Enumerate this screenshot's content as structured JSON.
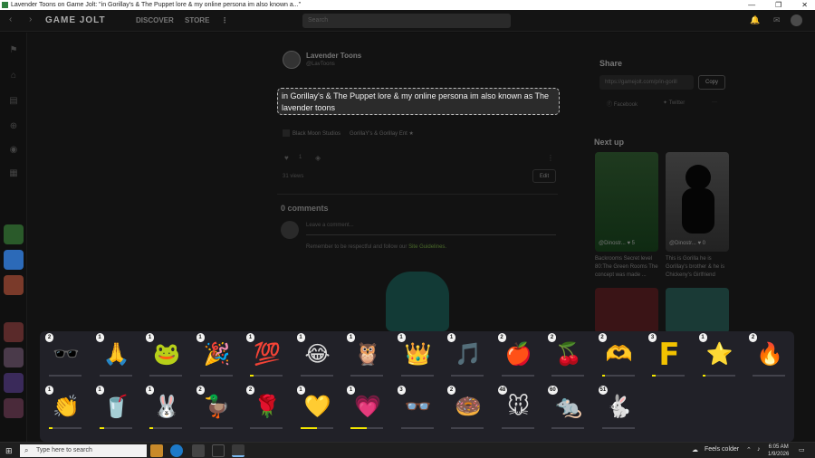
{
  "window": {
    "title": "Lavender Toons on Game Jolt: \"in Gorillay's & The Puppet lore & my online persona im also known a...\"",
    "controls": [
      "—",
      "❐",
      "✕"
    ]
  },
  "topbar": {
    "back": "‹",
    "forward": "›",
    "logo": "GAME JOLT",
    "discover": "DISCOVER",
    "store": "STORE",
    "more": "⋮",
    "search_placeholder": "Search"
  },
  "post": {
    "author": "Lavender Toons",
    "handle": "@LavToons",
    "body": "in Gorillay's & The Puppet lore & my online persona im also known as The lavender toons",
    "communities": [
      "Black Moon Studios",
      "GorillaY's & Gorillay Ent"
    ],
    "likes": "1",
    "views": "31 views",
    "edit_label": "Edit"
  },
  "comments": {
    "title": "0 comments",
    "placeholder": "Leave a comment...",
    "guidelines_prefix": "Remember to be respectful and follow our ",
    "guidelines_link": "Site Guidelines."
  },
  "share": {
    "title": "Share",
    "url": "https://gamejolt.com/p/in-gorill",
    "copy_label": "Copy",
    "facebook": "Facebook",
    "twitter": "Twitter",
    "more": "···"
  },
  "next_up": {
    "title": "Next up",
    "items": [
      {
        "user": "@Dinostr...",
        "likes": "5",
        "desc": "Backrooms Secret level 80:The Green Rooms The concept was made ..."
      },
      {
        "user": "@Dinostr...",
        "likes": "0",
        "desc": "This is Gorilla he is Gorillay's brother & he is Chickeny's Girlfriend"
      }
    ]
  },
  "stickers": [
    {
      "name": "sunglasses",
      "count": "2",
      "glyph": "🕶️",
      "progress": 0
    },
    {
      "name": "praying-hands",
      "count": "1",
      "glyph": "🙏",
      "progress": 0
    },
    {
      "name": "party-frog",
      "count": "1",
      "glyph": "🐸",
      "progress": 0
    },
    {
      "name": "party-popper",
      "count": "1",
      "glyph": "🎉",
      "progress": 0
    },
    {
      "name": "hundred",
      "count": "1",
      "glyph": "💯",
      "progress": 0.1
    },
    {
      "name": "laughing-face",
      "count": "1",
      "glyph": "😂",
      "progress": 0
    },
    {
      "name": "dizzy-owl",
      "count": "1",
      "glyph": "🦉",
      "progress": 0
    },
    {
      "name": "tiara",
      "count": "1",
      "glyph": "👑",
      "progress": 0
    },
    {
      "name": "music-notes",
      "count": "1",
      "glyph": "🎵",
      "progress": 0
    },
    {
      "name": "apple",
      "count": "2",
      "glyph": "🍎",
      "progress": 0
    },
    {
      "name": "cherries",
      "count": "2",
      "glyph": "🍒",
      "progress": 0
    },
    {
      "name": "heart-hands",
      "count": "2",
      "glyph": "🫶",
      "progress": 0.1
    },
    {
      "name": "letter-f",
      "count": "3",
      "glyph": "F",
      "progress": 0.1
    },
    {
      "name": "star",
      "count": "1",
      "glyph": "⭐",
      "progress": 0.1
    },
    {
      "name": "fire",
      "count": "2",
      "glyph": "🔥",
      "progress": 0
    },
    {
      "name": "clapping-hands",
      "count": "1",
      "glyph": "👏",
      "progress": 0.1
    },
    {
      "name": "chocolate-drink",
      "count": "1",
      "glyph": "🥤",
      "progress": 0.15
    },
    {
      "name": "green-bunny",
      "count": "1",
      "glyph": "🐰",
      "progress": 0.1
    },
    {
      "name": "duck",
      "count": "2",
      "glyph": "🦆",
      "progress": 0
    },
    {
      "name": "rose",
      "count": "2",
      "glyph": "🌹",
      "progress": 0
    },
    {
      "name": "sponge-heart",
      "count": "1",
      "glyph": "💛",
      "progress": 0.5
    },
    {
      "name": "pink-heart",
      "count": "1",
      "glyph": "💗",
      "progress": 0.5
    },
    {
      "name": "glasses",
      "count": "3",
      "glyph": "👓",
      "progress": 0
    },
    {
      "name": "donut",
      "count": "2",
      "glyph": "🍩",
      "progress": 0
    },
    {
      "name": "cool-mouse",
      "count": "48",
      "glyph": "🐭",
      "progress": 0
    },
    {
      "name": "running-mouse",
      "count": "60",
      "glyph": "🐀",
      "progress": 0
    },
    {
      "name": "grinning-bunny",
      "count": "51",
      "glyph": "🐇",
      "progress": 0
    }
  ],
  "taskbar": {
    "search_placeholder": "Type here to search",
    "weather": "Feels colder",
    "time": "6:05 AM",
    "date": "1/9/2026"
  },
  "colors": {
    "accent": "#f2e600",
    "panel": "#212128",
    "body_border": "#bbbbbb"
  }
}
